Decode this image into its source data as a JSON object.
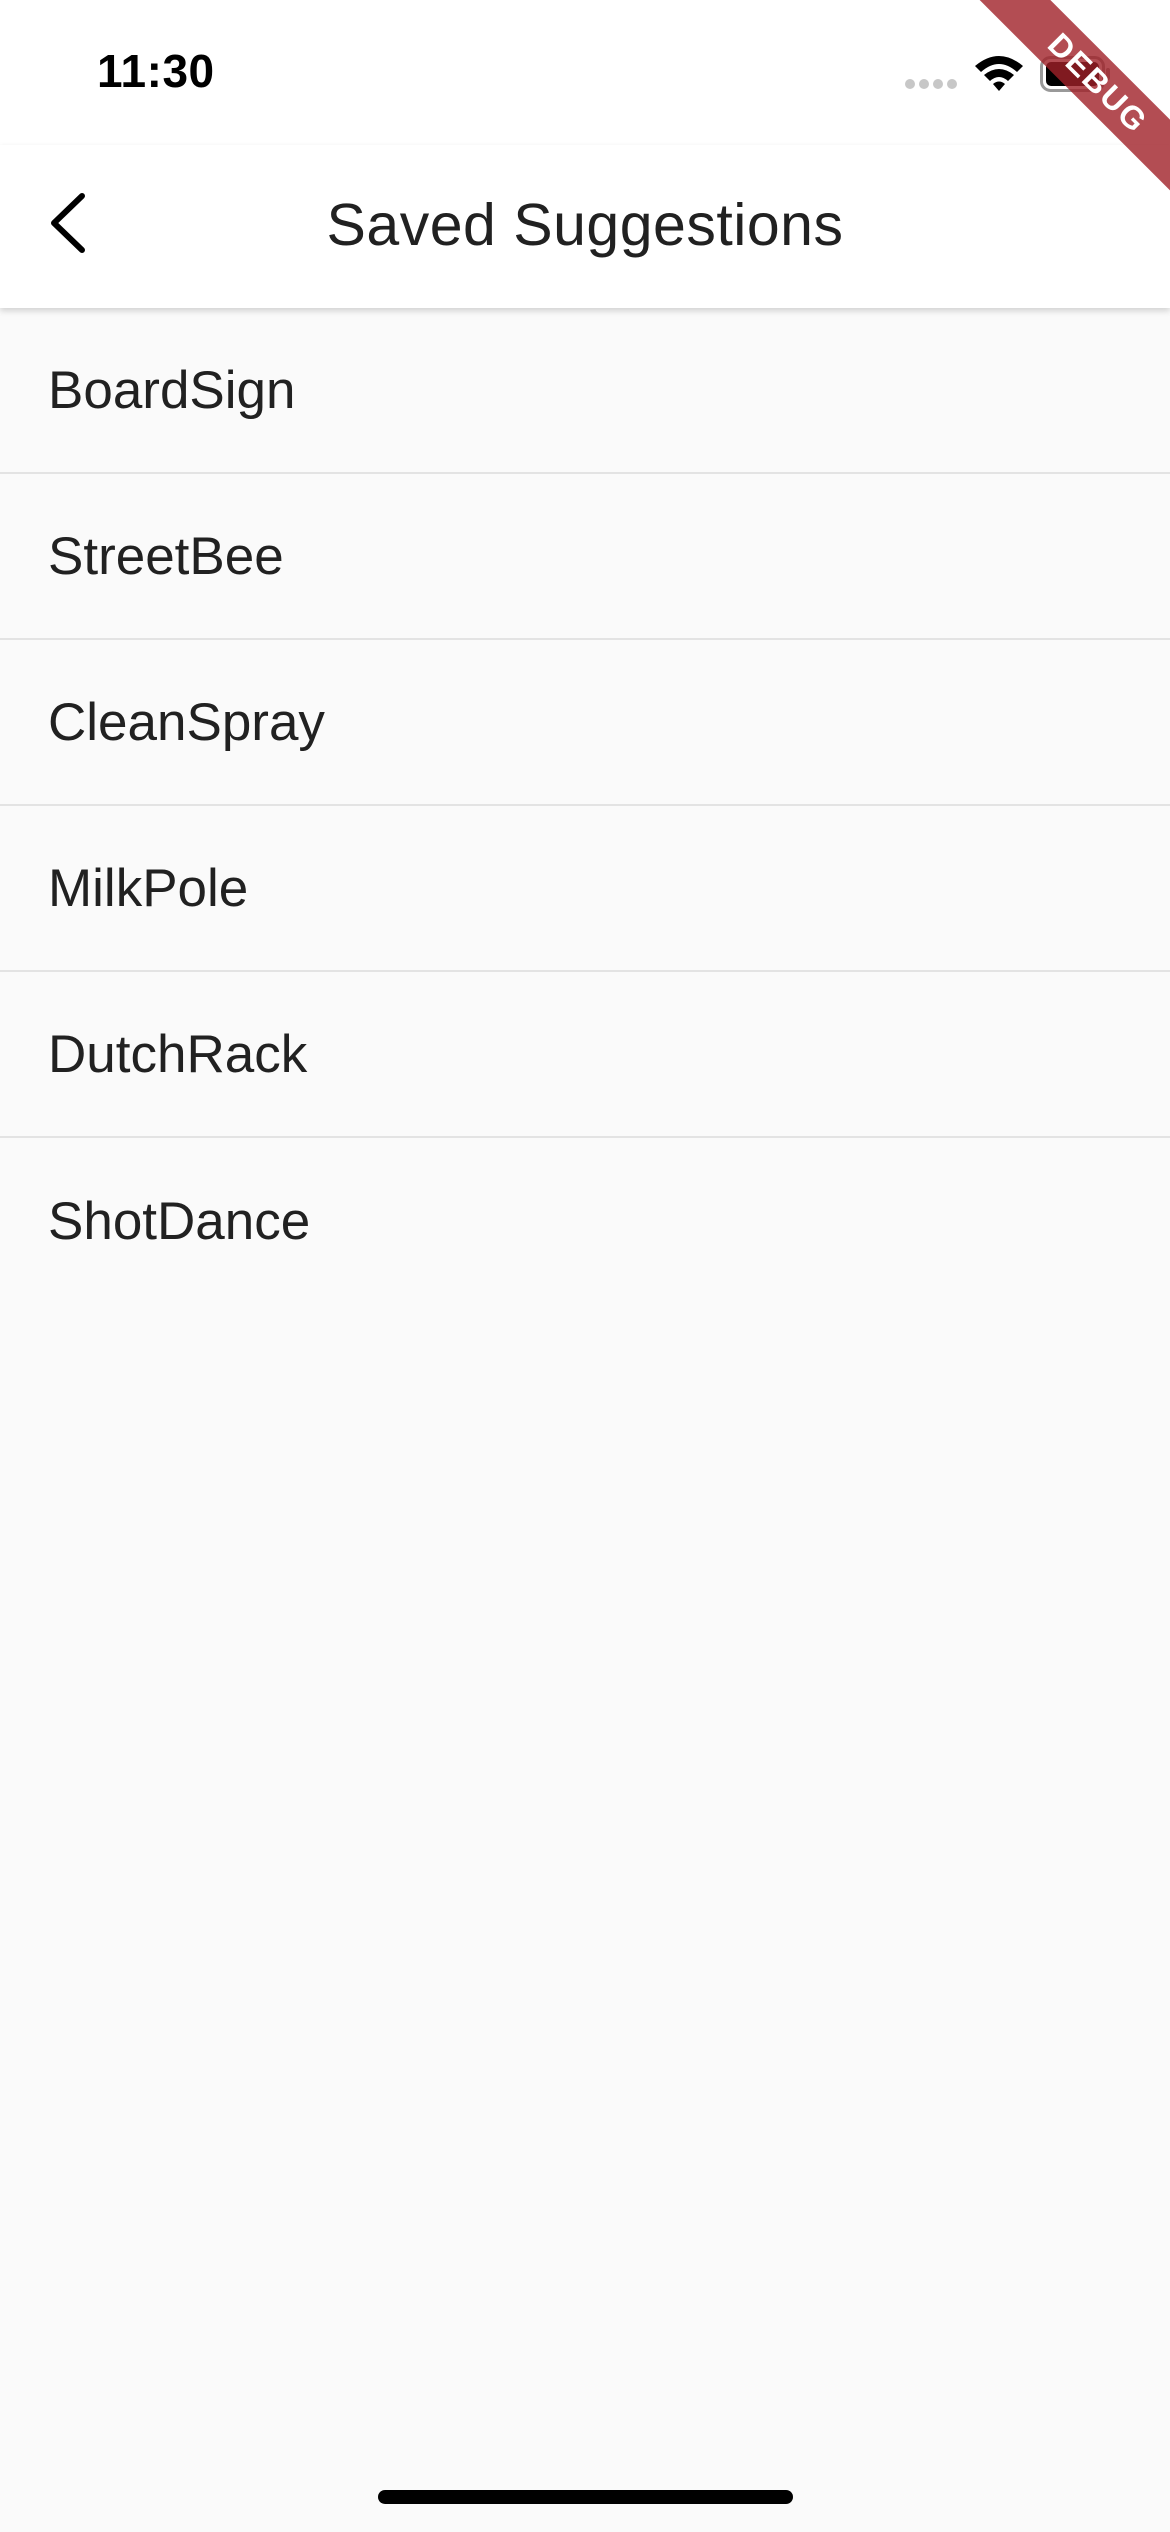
{
  "status_bar": {
    "time": "11:30",
    "icons": [
      "signal-dots-icon",
      "wifi-icon",
      "battery-icon"
    ]
  },
  "app_bar": {
    "back_icon": "chevron-left-icon",
    "title": "Saved Suggestions"
  },
  "saved_list": {
    "items": [
      "BoardSign",
      "StreetBee",
      "CleanSpray",
      "MilkPole",
      "DutchRack",
      "ShotDance"
    ]
  },
  "debug_banner": {
    "label": "DEBUG",
    "color": "#a02028"
  },
  "colors": {
    "background": "#fafafa",
    "app_bar": "#ffffff",
    "text": "#212121",
    "divider": "#e3e3e3"
  }
}
